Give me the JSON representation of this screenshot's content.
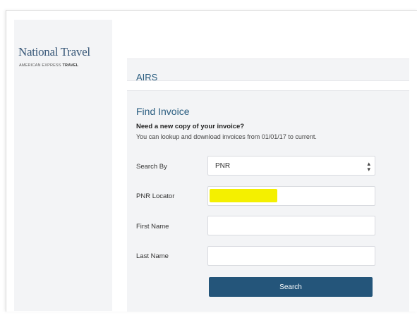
{
  "brand": {
    "logo_main": "National Travel",
    "logo_sub_prefix": "AMERICAN EXPRESS",
    "logo_sub_bold": "TRAVEL"
  },
  "header": {
    "title": "AIRS"
  },
  "find_invoice": {
    "title": "Find Invoice",
    "subtitle": "Need a new copy of your invoice?",
    "description": "You can lookup and download invoices from 01/01/17 to current.",
    "fields": {
      "search_by": {
        "label": "Search By",
        "value": "PNR"
      },
      "pnr_locator": {
        "label": "PNR Locator",
        "value": ""
      },
      "first_name": {
        "label": "First Name",
        "value": ""
      },
      "last_name": {
        "label": "Last Name",
        "value": ""
      }
    },
    "search_button": "Search"
  },
  "colors": {
    "accent": "#2a5d80",
    "button": "#24557a",
    "panel": "#f3f4f6",
    "redaction_highlight": "#f4f000"
  },
  "icons": {
    "select_arrow": "up-down-caret-icon"
  }
}
